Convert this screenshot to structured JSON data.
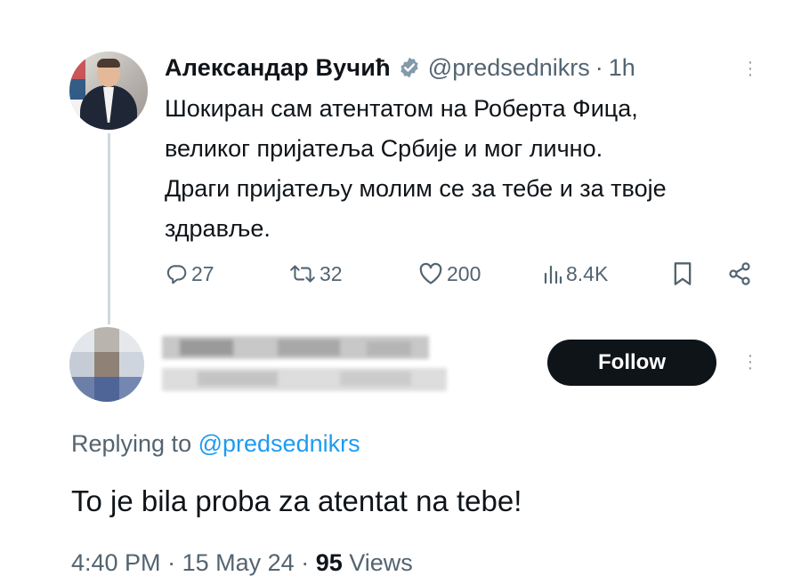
{
  "tweet": {
    "author_name": "Александар Вучић",
    "handle": "@predsednikrs",
    "separator": "·",
    "time": "1h",
    "text_lines": [
      "Шокиран сам атентатом на Роберта Фица,",
      "великог пријатеља Србије и мог лично.",
      "Драги пријатељу молим се за тебе и за твоје",
      "здравље."
    ],
    "stats": {
      "replies": "27",
      "retweets": "32",
      "likes": "200",
      "views": "8.4K"
    },
    "icons": {
      "verified": "verified-badge-icon",
      "reply": "reply-icon",
      "retweet": "retweet-icon",
      "like": "heart-icon",
      "views": "analytics-icon",
      "bookmark": "bookmark-icon",
      "share": "share-icon",
      "more": "more-vertical-icon"
    }
  },
  "reply": {
    "follow_label": "Follow",
    "replying_prefix": "Replying to",
    "replying_mention": "@predsednikrs",
    "text": "To je bila proba za atentat na tebe!",
    "time": "4:40 PM",
    "separator": "·",
    "date": "15 May 24",
    "views_count": "95",
    "views_label": "Views"
  },
  "colors": {
    "text": "#0f1419",
    "secondary": "#536471",
    "link": "#1d9bf0",
    "follow_bg": "#0f1419",
    "thread_line": "#cfd9de"
  }
}
